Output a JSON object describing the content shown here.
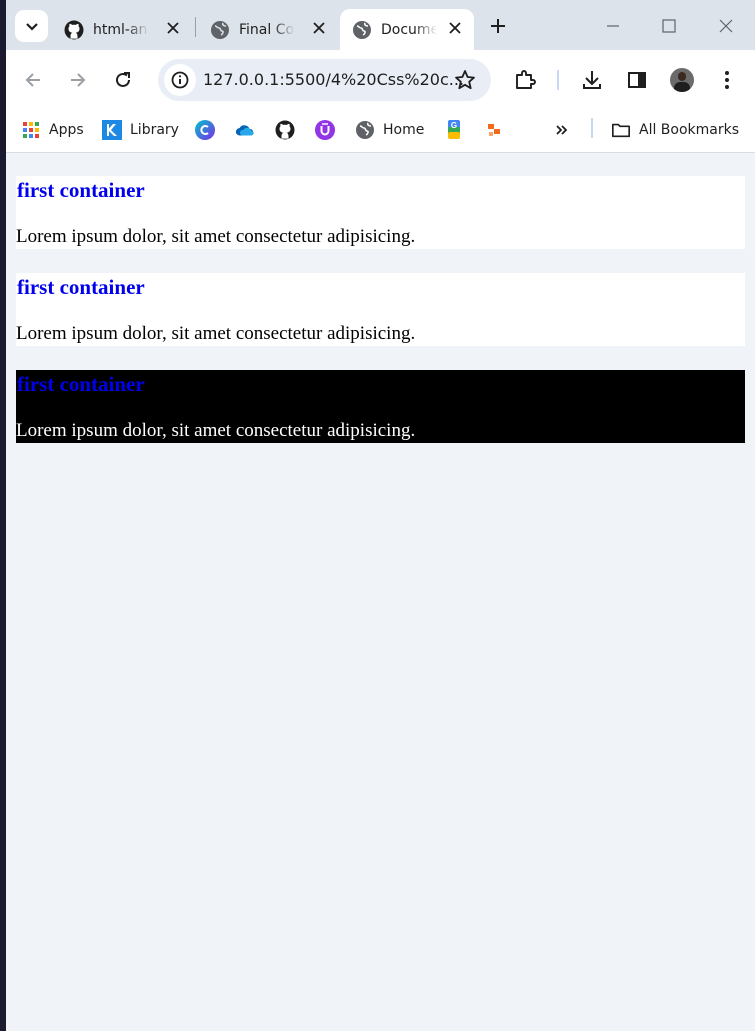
{
  "browser": {
    "tabs": [
      {
        "title": "html-an",
        "icon": "github-icon",
        "active": false
      },
      {
        "title": "Final Co",
        "icon": "globe-icon",
        "active": false
      },
      {
        "title": "Docume",
        "icon": "globe-icon",
        "active": true
      }
    ],
    "address_bar": {
      "url": "127.0.0.1:5500/4%20Css%20c..."
    },
    "bookmarks": [
      {
        "label": "Apps",
        "icon": "apps-grid-icon"
      },
      {
        "label": "Library",
        "icon": "library-icon"
      },
      {
        "label": "",
        "icon": "canva-icon"
      },
      {
        "label": "",
        "icon": "onedrive-icon"
      },
      {
        "label": "",
        "icon": "github-icon"
      },
      {
        "label": "",
        "icon": "u-icon"
      },
      {
        "label": "Home",
        "icon": "globe-icon"
      },
      {
        "label": "",
        "icon": "google-apps-icon"
      },
      {
        "label": "",
        "icon": "orange-app-icon"
      }
    ],
    "all_bookmarks_label": "All Bookmarks"
  },
  "page": {
    "containers": [
      {
        "heading": "first container",
        "text": "Lorem ipsum dolor, sit amet consectetur adipisicing.",
        "theme": "light"
      },
      {
        "heading": "first container",
        "text": "Lorem ipsum dolor, sit amet consectetur adipisicing.",
        "theme": "light"
      },
      {
        "heading": "first container",
        "text": "Lorem ipsum dolor, sit amet consectetur adipisicing.",
        "theme": "dark"
      }
    ]
  },
  "colors": {
    "heading": "#0000ee",
    "page_background": "#f0f3f7",
    "dark_container": "#000000"
  }
}
